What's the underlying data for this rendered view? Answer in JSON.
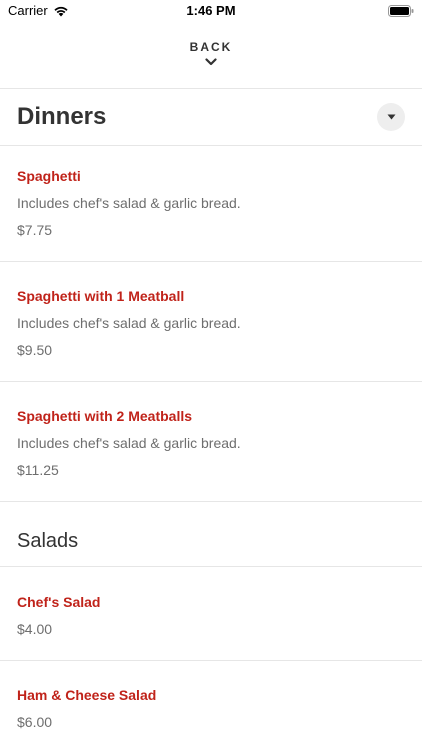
{
  "status_bar": {
    "carrier": "Carrier",
    "time": "1:46 PM",
    "wifi_icon": "wifi-icon",
    "battery_icon": "battery-icon"
  },
  "nav": {
    "back_label": "BACK",
    "back_icon": "chevron-down-icon"
  },
  "sections": {
    "dinners": {
      "title": "Dinners",
      "dropdown_icon": "caret-down-icon",
      "items": [
        {
          "name": "Spaghetti",
          "description": "Includes chef's salad & garlic bread.",
          "price": "$7.75"
        },
        {
          "name": "Spaghetti with 1 Meatball",
          "description": "Includes chef's salad & garlic bread.",
          "price": "$9.50"
        },
        {
          "name": "Spaghetti with 2 Meatballs",
          "description": "Includes chef's salad & garlic bread.",
          "price": "$11.25"
        }
      ]
    },
    "salads": {
      "title": "Salads",
      "items": [
        {
          "name": "Chef's Salad",
          "price": "$4.00"
        },
        {
          "name": "Ham & Cheese Salad",
          "price": "$6.00"
        }
      ]
    }
  },
  "colors": {
    "item_name": "#c0231a",
    "secondary_text": "#6e6e6e",
    "heading": "#333333",
    "divider": "#e6e6e6"
  }
}
